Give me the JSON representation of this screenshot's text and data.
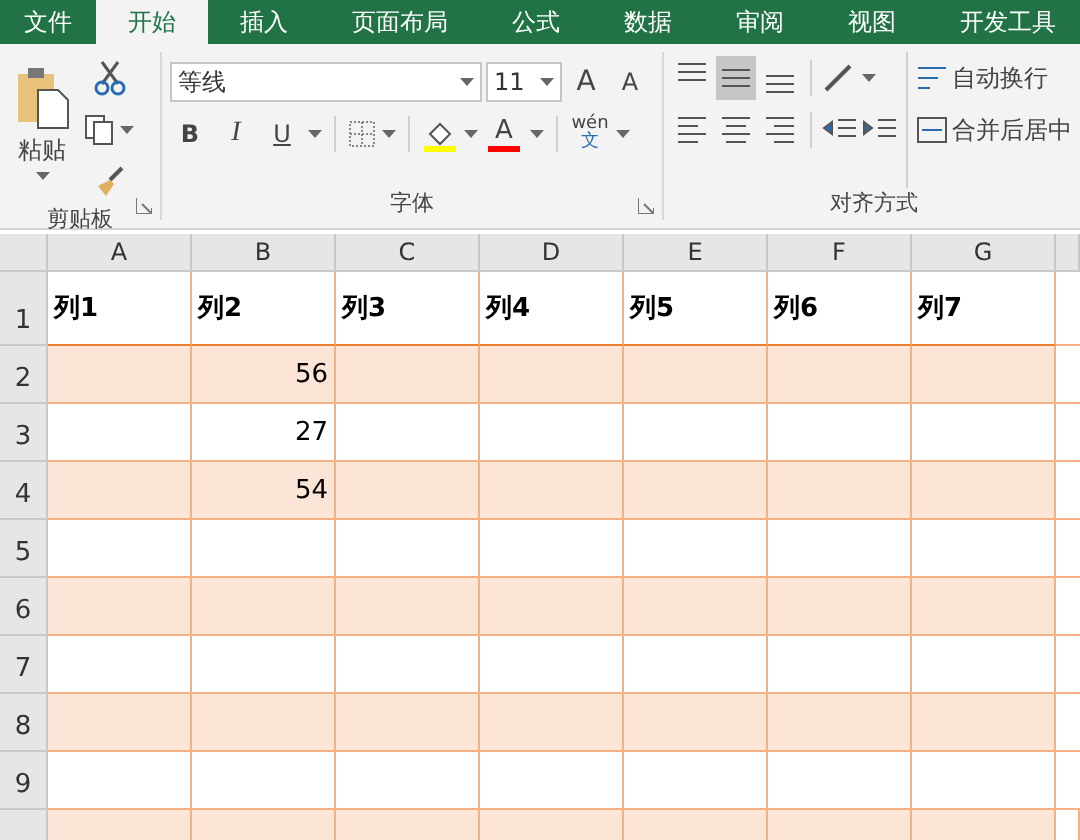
{
  "tabs": [
    {
      "label": "文件",
      "selected": false
    },
    {
      "label": "开始",
      "selected": true
    },
    {
      "label": "插入",
      "selected": false
    },
    {
      "label": "页面布局",
      "selected": false
    },
    {
      "label": "公式",
      "selected": false
    },
    {
      "label": "数据",
      "selected": false
    },
    {
      "label": "审阅",
      "selected": false
    },
    {
      "label": "视图",
      "selected": false
    },
    {
      "label": "开发工具",
      "selected": false
    }
  ],
  "ribbon": {
    "clipboard": {
      "paste_label": "粘贴",
      "group_label": "剪贴板"
    },
    "font": {
      "font_name": "等线",
      "font_size": "11",
      "grow_label": "A",
      "shrink_label": "A",
      "bold_label": "B",
      "italic_label": "I",
      "underline_label": "U",
      "font_color_label": "A",
      "phonetic_top": "wén",
      "phonetic_bottom": "文",
      "group_label": "字体"
    },
    "alignment": {
      "vertical": [
        {
          "kind": "top",
          "selected": false
        },
        {
          "kind": "middle",
          "selected": true
        },
        {
          "kind": "bottom",
          "selected": false
        }
      ],
      "horizontal": [
        {
          "kind": "left",
          "selected": false
        },
        {
          "kind": "center",
          "selected": false
        },
        {
          "kind": "right",
          "selected": false
        }
      ],
      "wrap_text": "自动换行",
      "merge_center": "合并后居中",
      "group_label": "对齐方式"
    }
  },
  "sheet": {
    "columns": [
      "A",
      "B",
      "C",
      "D",
      "E",
      "F",
      "G"
    ],
    "rows": [
      {
        "label": "1",
        "kind": "header",
        "shaded": false,
        "cells": [
          "列1",
          "列2",
          "列3",
          "列4",
          "列5",
          "列6",
          "列7"
        ]
      },
      {
        "label": "2",
        "kind": "data",
        "shaded": true,
        "column_b": "56"
      },
      {
        "label": "3",
        "kind": "data",
        "shaded": false,
        "column_b": "27"
      },
      {
        "label": "4",
        "kind": "data",
        "shaded": true,
        "column_b": "54"
      },
      {
        "label": "5",
        "kind": "data",
        "shaded": false
      },
      {
        "label": "6",
        "kind": "data",
        "shaded": true
      },
      {
        "label": "7",
        "kind": "data",
        "shaded": false
      },
      {
        "label": "8",
        "kind": "data",
        "shaded": true
      },
      {
        "label": "9",
        "kind": "data",
        "shaded": false
      }
    ]
  }
}
